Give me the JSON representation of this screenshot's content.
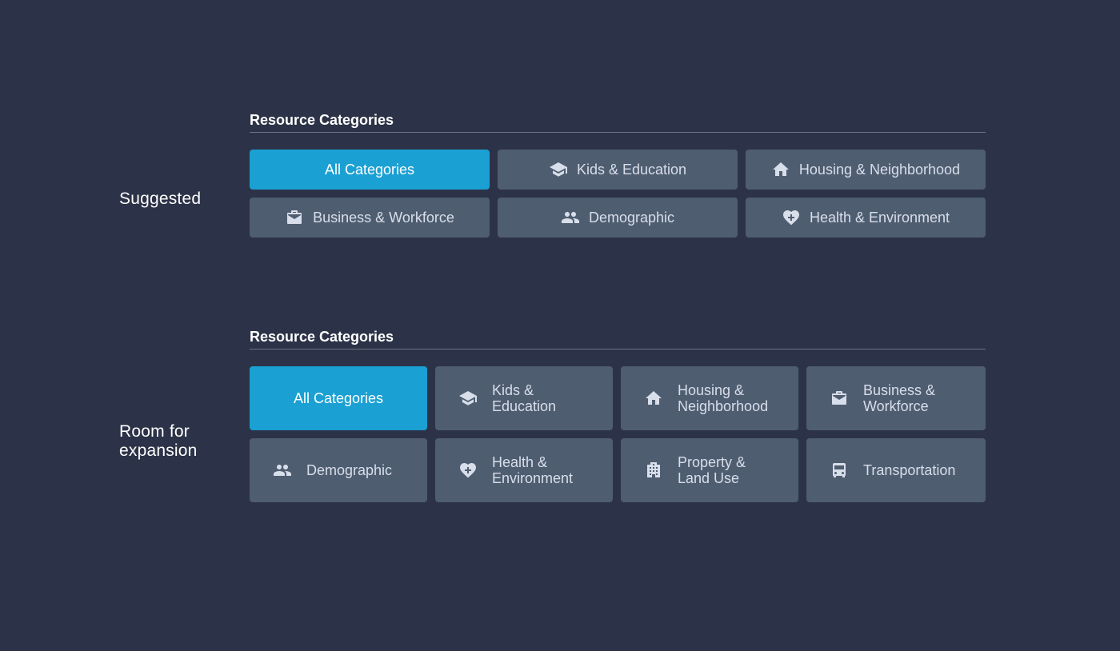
{
  "sections": {
    "suggested": {
      "label": "Suggested",
      "title": "Resource Categories",
      "tiles": [
        {
          "label": "All Categories",
          "active": true
        },
        {
          "label": "Kids & Education",
          "icon": "graduation-cap-icon"
        },
        {
          "label": "Housing & Neighborhood",
          "icon": "house-icon"
        },
        {
          "label": "Business & Workforce",
          "icon": "briefcase-icon"
        },
        {
          "label": "Demographic",
          "icon": "people-icon"
        },
        {
          "label": "Health & Environment",
          "icon": "heart-plus-icon"
        }
      ]
    },
    "expansion": {
      "label": "Room for expansion",
      "title": "Resource Categories",
      "tiles": [
        {
          "label": "All Categories",
          "active": true
        },
        {
          "label": "Kids &\nEducation",
          "icon": "graduation-cap-icon"
        },
        {
          "label": "Housing &\nNeighborhood",
          "icon": "house-icon"
        },
        {
          "label": "Business &\nWorkforce",
          "icon": "briefcase-icon"
        },
        {
          "label": "Demographic",
          "icon": "people-icon"
        },
        {
          "label": "Health &\nEnvironment",
          "icon": "heart-plus-icon"
        },
        {
          "label": "Property &\nLand Use",
          "icon": "buildings-icon"
        },
        {
          "label": "Transportation",
          "icon": "car-icon"
        }
      ]
    }
  },
  "colors": {
    "background": "#2c3348",
    "tile": "#4f5d71",
    "active": "#1ba0d3",
    "icon": "#d8deea"
  }
}
